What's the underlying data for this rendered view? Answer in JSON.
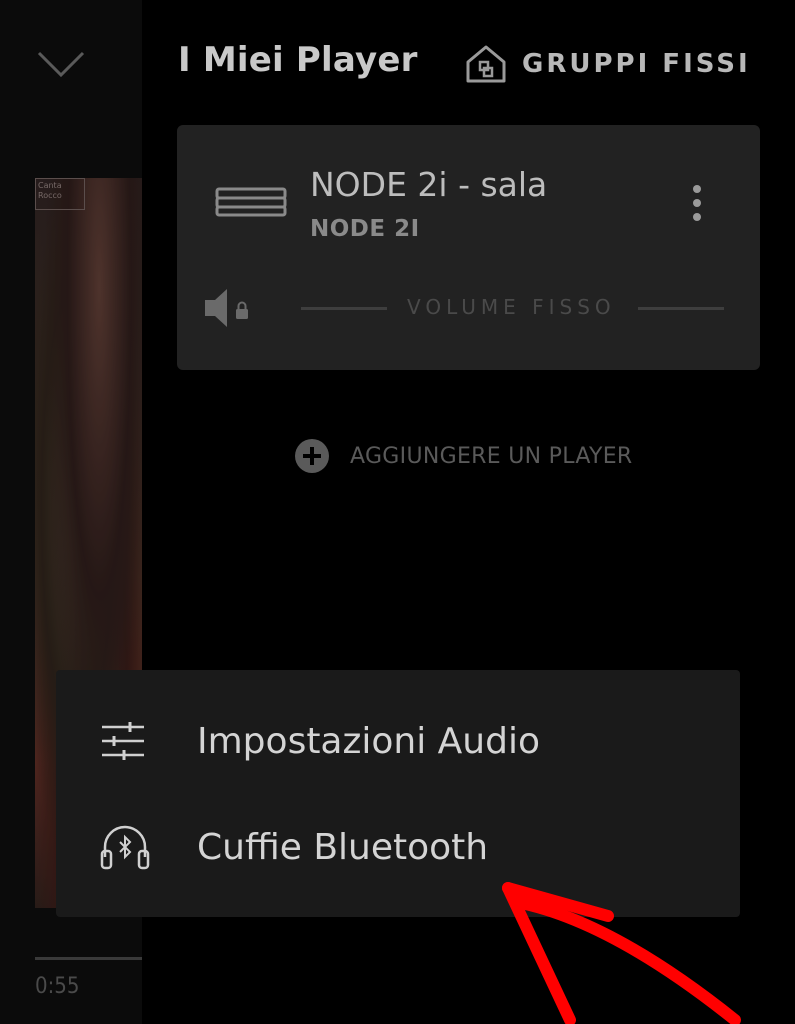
{
  "header": {
    "title": "I Miei Player",
    "groups_label": "GRUPPI FISSI"
  },
  "now_playing": {
    "elapsed": "0:55",
    "album_badge_text": "Canta Rocco"
  },
  "player_card": {
    "name": "NODE 2i - sala",
    "model": "NODE 2I",
    "volume_label": "VOLUME FISSO"
  },
  "add_player": {
    "label": "AGGIUNGERE UN PLAYER"
  },
  "menu": {
    "items": [
      {
        "label": "Impostazioni Audio",
        "icon": "sliders-icon"
      },
      {
        "label": "Cuffie Bluetooth",
        "icon": "bluetooth-headphones-icon"
      }
    ]
  },
  "colors": {
    "background": "#000000",
    "card": "#222222",
    "menu": "#1a1a1a",
    "annotation": "#ff0000"
  }
}
